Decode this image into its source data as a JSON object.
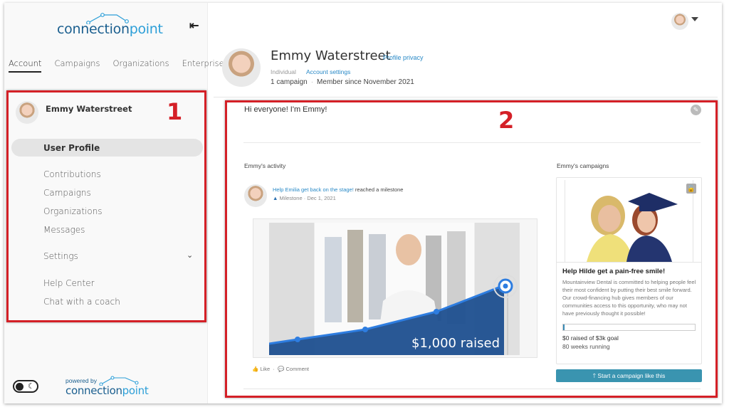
{
  "brand": {
    "logo_text_a": "connection",
    "logo_text_b": "point",
    "powered_by": "powered by",
    "accent": "#2d9fd8",
    "brand_dark": "#1b5f8f"
  },
  "sidebar": {
    "collapse_icon": "collapse-left-icon",
    "collapse_glyph": "⇤",
    "tabs": [
      {
        "label": "Account",
        "active": true
      },
      {
        "label": "Campaigns",
        "active": false
      },
      {
        "label": "Organizations",
        "active": false
      },
      {
        "label": "Enterprise",
        "active": false
      }
    ],
    "user_name": "Emmy Waterstreet",
    "items": [
      {
        "label": "User Profile",
        "active": true
      },
      {
        "label": "Contributions"
      },
      {
        "label": "Campaigns"
      },
      {
        "label": "Organizations"
      },
      {
        "label": "Messages"
      },
      {
        "label": "Settings",
        "expandable": true
      },
      {
        "label": "Help Center"
      },
      {
        "label": "Chat with a coach"
      }
    ],
    "chevron_glyph": "⌄",
    "moon_glyph": "☾"
  },
  "annotations": {
    "box1": "1",
    "box2": "2",
    "color": "#d42027"
  },
  "profile": {
    "name": "Emmy Waterstreet",
    "privacy_link": "Profile privacy",
    "type": "Individual",
    "account_settings": "Account settings",
    "campaign_count": "1 campaign",
    "member_since": "Member since November 2021",
    "greeting": "Hi everyone! I'm Emmy!",
    "edit_glyph": "✎"
  },
  "activity": {
    "heading": "Emmy's activity",
    "items": [
      {
        "campaign_link": "Help Emilia get back on the stage!",
        "action": "reached a milestone",
        "type_glyph": "▲",
        "type": "Milestone",
        "date": "Dec 1, 2021",
        "raised_label": "$1,000 raised",
        "like": "Like",
        "comment": "Comment",
        "like_glyph": "👍",
        "comment_glyph": "💬"
      }
    ]
  },
  "campaigns": {
    "heading": "Emmy's campaigns",
    "lock_glyph": "🔓",
    "items": [
      {
        "title": "Help Hilde get a pain-free smile!",
        "description": "Mountainview Dental is committed to helping people feel their most confident by putting their best smile forward. Our crowd-financing hub gives members of our communities access to this opportunity, who may not have previously thought it possible!",
        "progress_fraction": 0.0,
        "raised": "$0 raised of $3k goal",
        "running": "80 weeks running"
      }
    ],
    "start_button": "🡑 Start a campaign like this"
  }
}
